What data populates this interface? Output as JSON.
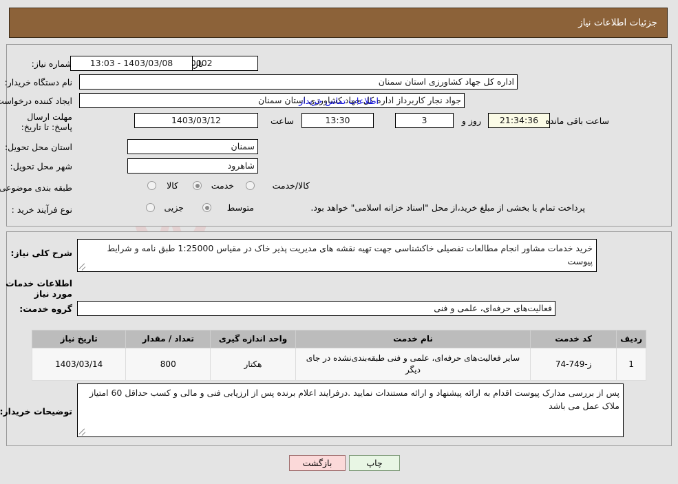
{
  "header": {
    "title": "جزئیات اطلاعات نیاز"
  },
  "watermark": {
    "text": "AriaTender.net",
    "logo_color": "#e8b9b9"
  },
  "top_panel": {
    "need_number": {
      "label": "شماره نیاز:",
      "value": "1103003201000002"
    },
    "announce_datetime": {
      "label": "تاریخ و ساعت اعلان عمومی:",
      "value": "1403/03/08 - 13:03"
    },
    "buyer_org": {
      "label": "نام دستگاه خریدار:",
      "value": "اداره کل جهاد کشاورزی استان سمنان"
    },
    "request_creator": {
      "label": "ایجاد کننده درخواست:",
      "value": "جواد نجار کاربرداز اداره کل جهاد کشاورزی استان سمنان"
    },
    "buyer_contact_link": "اطلاعات تماس خریدار",
    "deadline": {
      "label": "مهلت ارسال پاسخ: تا تاریخ:",
      "date": "1403/03/12",
      "time_label": "ساعت",
      "time": "13:30",
      "days": "3",
      "days_label": "روز و",
      "countdown": "21:34:36",
      "countdown_label": "ساعت باقی مانده"
    },
    "delivery_province": {
      "label": "استان محل تحویل:",
      "value": "سمنان"
    },
    "delivery_city": {
      "label": "شهر محل تحویل:",
      "value": "شاهرود"
    },
    "subject_category": {
      "label": "طبقه بندی موضوعی:",
      "options": [
        "کالا",
        "خدمت",
        "کالا/خدمت"
      ],
      "selected": "خدمت"
    },
    "purchase_type": {
      "label": "نوع فرآیند خرید :",
      "options": [
        "جزیی",
        "متوسط"
      ],
      "selected": "متوسط"
    },
    "payment_note": "پرداخت تمام یا بخشی از مبلغ خرید،از محل \"اسناد خزانه اسلامی\" خواهد بود."
  },
  "bottom_panel": {
    "general_description": {
      "label": "شرح کلی نیاز:",
      "value": "خرید خدمات مشاور انجام مطالعات تفصیلی خاکشناسی جهت تهیه نقشه های مدیریت پذیر خاک در مقیاس 1:25000 طبق نامه و شرایط پیوست"
    },
    "section_heading": "اطلاعات خدمات مورد نیاز",
    "service_group": {
      "label": "گروه خدمت:",
      "value": "فعالیت‌های حرفه‌ای، علمی و فنی"
    },
    "table": {
      "columns": [
        "ردیف",
        "کد خدمت",
        "نام خدمت",
        "واحد اندازه گیری",
        "تعداد / مقدار",
        "تاریخ نیاز"
      ],
      "rows": [
        {
          "radif": "1",
          "code": "ز-749-74",
          "name": "سایر فعالیت‌های حرفه‌ای، علمی و فنی طبقه‌بندی‌نشده در جای دیگر",
          "unit": "هکتار",
          "quantity": "800",
          "date": "1403/03/14"
        }
      ]
    },
    "buyer_notes": {
      "label": "توضیحات خریدار:",
      "value": "پس از بررسی مدارک پیوست اقدام به ارائه پیشنهاد و ارائه مستندات نمایید .درفرایند اعلام برنده پس از ارزیابی فنی و مالی و کسب حداقل 60 امتیاز ملاک عمل می باشد"
    }
  },
  "footer": {
    "print_button": "چاپ",
    "back_button": "بازگشت"
  }
}
